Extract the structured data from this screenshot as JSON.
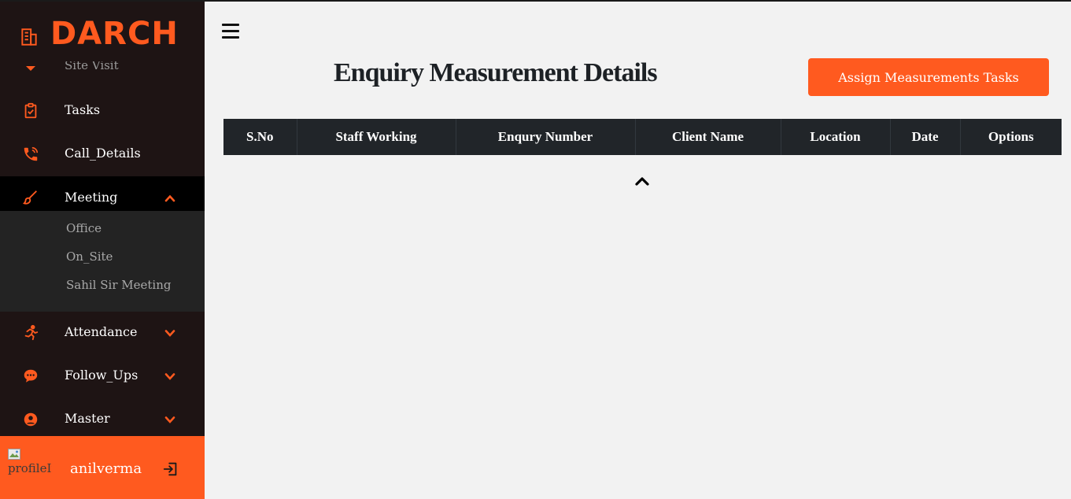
{
  "brand": {
    "name": "DARCH",
    "accent": "#ff5a1f"
  },
  "sidebar": {
    "partial_item": {
      "label": "Site Visit",
      "icon": "chevron-down-icon"
    },
    "items": [
      {
        "label": "Tasks",
        "icon": "clipboard-check-icon"
      },
      {
        "label": "Call_Details",
        "icon": "phone-icon"
      },
      {
        "label": "Meeting",
        "icon": "brush-icon",
        "expanded": true
      },
      {
        "label": "Attendance",
        "icon": "running-person-icon"
      },
      {
        "label": "Follow_Ups",
        "icon": "chat-bubble-icon"
      },
      {
        "label": "Master",
        "icon": "user-circle-icon"
      }
    ],
    "meeting_submenu": [
      "Office",
      "On_Site",
      "Sahil Sir Meeting"
    ]
  },
  "user": {
    "avatar_alt": "profileImg",
    "name": "anilverma"
  },
  "main": {
    "title": "Enquiry Measurement Details",
    "assign_button": "Assign Measurements Tasks",
    "table": {
      "headers": [
        "S.No",
        "Staff Working",
        "Enqury Number",
        "Client Name",
        "Location",
        "Date",
        "Options"
      ]
    }
  }
}
